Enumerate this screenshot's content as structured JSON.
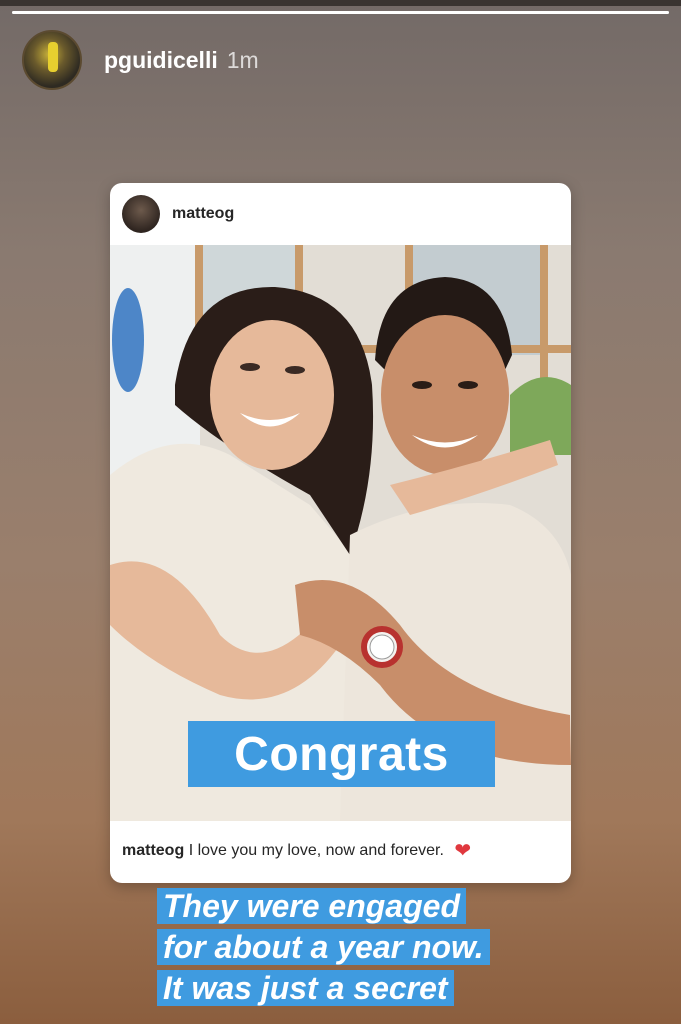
{
  "story": {
    "username": "pguidicelli",
    "time_ago": "1m",
    "progress_fraction": 1.0
  },
  "post": {
    "username": "matteog",
    "caption_username": "matteog",
    "caption_text": "I love you my love, now and forever.",
    "heart_icon": "red-heart-emoji"
  },
  "stickers": {
    "congrats": "Congrats",
    "caption_lines": [
      "They were engaged",
      "for about a year now.",
      "It was just a secret"
    ]
  },
  "colors": {
    "sticker_blue": "#3f9be0",
    "heart_red": "#e0383e"
  }
}
